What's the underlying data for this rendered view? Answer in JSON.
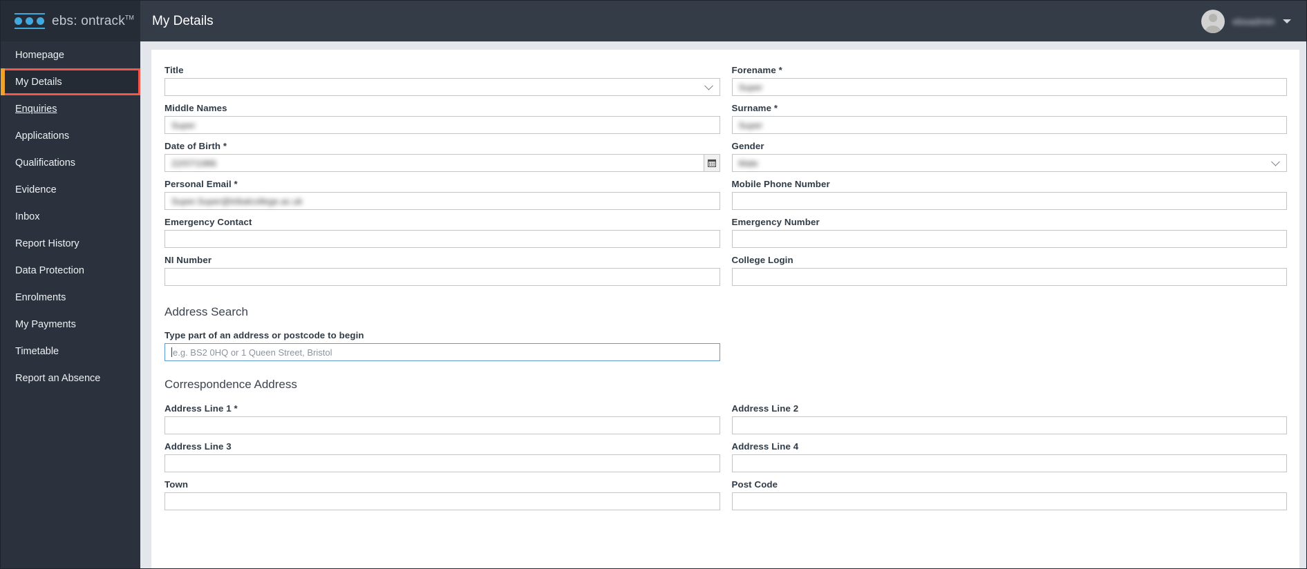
{
  "brand": {
    "name": "ebs: ontrack",
    "tm": "TM",
    "logo_color": "#3fa9e0"
  },
  "header": {
    "page_title": "My Details",
    "username": "ebsadmin",
    "background": "#343c48"
  },
  "sidebar": {
    "background": "#2b323d",
    "highlight_color": "#f4564a",
    "items": [
      {
        "label": "Homepage",
        "state": "default"
      },
      {
        "label": "My Details",
        "state": "highlighted"
      },
      {
        "label": "Enquiries",
        "state": "hovered"
      },
      {
        "label": "Applications",
        "state": "default"
      },
      {
        "label": "Qualifications",
        "state": "default"
      },
      {
        "label": "Evidence",
        "state": "default"
      },
      {
        "label": "Inbox",
        "state": "default"
      },
      {
        "label": "Report History",
        "state": "default"
      },
      {
        "label": "Data Protection",
        "state": "default"
      },
      {
        "label": "Enrolments",
        "state": "default"
      },
      {
        "label": "My Payments",
        "state": "default"
      },
      {
        "label": "Timetable",
        "state": "default"
      },
      {
        "label": "Report an Absence",
        "state": "default"
      }
    ]
  },
  "form": {
    "personal": {
      "title": {
        "label": "Title",
        "value": "",
        "type": "select"
      },
      "forename": {
        "label": "Forename *",
        "value": "Super",
        "type": "text",
        "redacted": true
      },
      "middle_names": {
        "label": "Middle Names",
        "value": "Super",
        "type": "text",
        "redacted": true
      },
      "surname": {
        "label": "Surname *",
        "value": "Super",
        "type": "text",
        "redacted": true
      },
      "date_of_birth": {
        "label": "Date of Birth *",
        "value": "22/07/1986",
        "type": "date",
        "redacted": true
      },
      "gender": {
        "label": "Gender",
        "value": "Male",
        "type": "select",
        "redacted": true
      },
      "personal_email": {
        "label": "Personal Email *",
        "value": "Super.Super@tribalcollege.ac.uk",
        "type": "text",
        "redacted": true
      },
      "mobile_phone_number": {
        "label": "Mobile Phone Number",
        "value": "",
        "type": "text"
      },
      "emergency_contact": {
        "label": "Emergency Contact",
        "value": "",
        "type": "text"
      },
      "emergency_number": {
        "label": "Emergency Number",
        "value": "",
        "type": "text"
      },
      "ni_number": {
        "label": "NI Number",
        "value": "",
        "type": "text"
      },
      "college_login": {
        "label": "College Login",
        "value": "",
        "type": "text"
      }
    },
    "address_search": {
      "heading": "Address Search",
      "field_label": "Type part of an address or postcode to begin",
      "placeholder": "e.g. BS2 0HQ or 1 Queen Street, Bristol",
      "value": "",
      "focused": true
    },
    "correspondence_address": {
      "heading": "Correspondence Address",
      "address_line_1": {
        "label": "Address Line 1 *",
        "value": ""
      },
      "address_line_2": {
        "label": "Address Line 2",
        "value": ""
      },
      "address_line_3": {
        "label": "Address Line 3",
        "value": ""
      },
      "address_line_4": {
        "label": "Address Line 4",
        "value": ""
      },
      "town": {
        "label": "Town",
        "value": ""
      },
      "post_code": {
        "label": "Post Code",
        "value": ""
      }
    }
  }
}
